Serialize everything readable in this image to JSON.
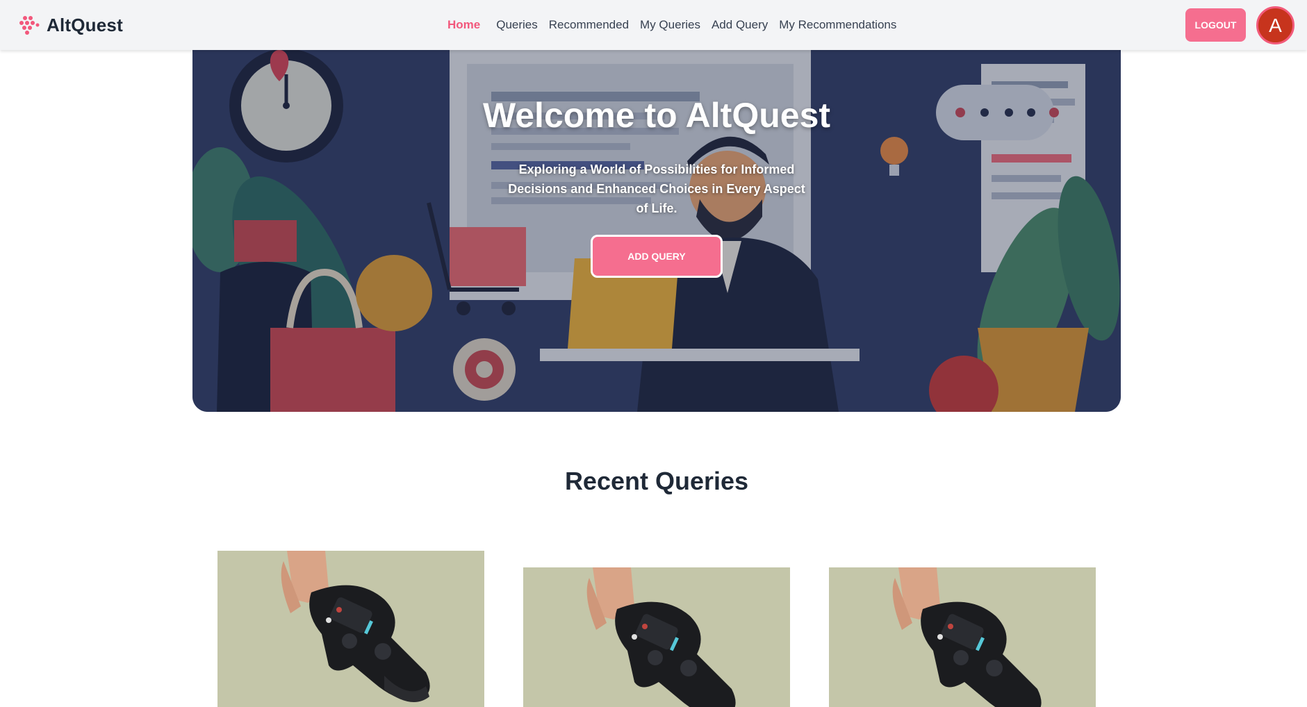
{
  "brand": {
    "name": "AltQuest",
    "logo_icon": "dots-grid-logo-icon",
    "accent": "#f2587c"
  },
  "nav": {
    "items": [
      {
        "label": "Home",
        "active": true
      },
      {
        "label": "Queries",
        "active": false
      },
      {
        "label": "Recommended",
        "active": false
      },
      {
        "label": "My Queries",
        "active": false
      },
      {
        "label": "Add Query",
        "active": false
      },
      {
        "label": "My Recommendations",
        "active": false
      }
    ],
    "logout_label": "LOGOUT",
    "avatar_initial": "A"
  },
  "hero": {
    "title": "Welcome to AltQuest",
    "subtitle": "Exploring a World of Possibilities for Informed Decisions and Enhanced Choices in Every Aspect of Life.",
    "button_label": "ADD QUERY"
  },
  "recent": {
    "title": "Recent Queries",
    "cards": [
      {
        "image": "game-controller-photo"
      },
      {
        "image": "game-controller-photo"
      },
      {
        "image": "game-controller-photo"
      }
    ]
  },
  "colors": {
    "primary_button": "#f56e8f",
    "heading": "#1f2937",
    "avatar_bg": "#c7341d"
  }
}
